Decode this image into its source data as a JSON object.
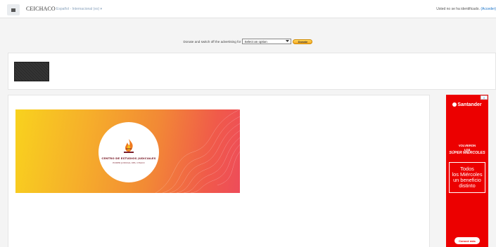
{
  "navbar": {
    "brand": "CEICHACO",
    "language": "Español - Internacional (es) ▾",
    "login_prefix": "Usted no se ha identificado. ",
    "login_link": "(Acceder)"
  },
  "donate": {
    "text": "Donate and switch off the advertising for",
    "select_value": "Select an option",
    "button_label": "Donate"
  },
  "banner": {
    "title": "CENTRO DE ESTUDIOS JUDICIALES",
    "subtitle": "PODER JUDICIAL DEL CHACO"
  },
  "ad": {
    "close_label": "✕",
    "brand": "Santander",
    "line1": "VOLVIERON\nLOS",
    "line2": "SÚPER MIÉRCOLES",
    "box_text": "Todos\nlos Miércoles\nun beneficio\ndistinto",
    "cta": "Conocé más"
  },
  "colors": {
    "ad_red": "#ec0000",
    "link_blue": "#1a73c8",
    "banner_gradient": [
      "#f8d21e",
      "#f28a35",
      "#ee4c5a"
    ]
  },
  "icons": {
    "menu": "hamburger-icon",
    "dropdown": "chevron-down-icon",
    "flame": "flame-icon"
  }
}
